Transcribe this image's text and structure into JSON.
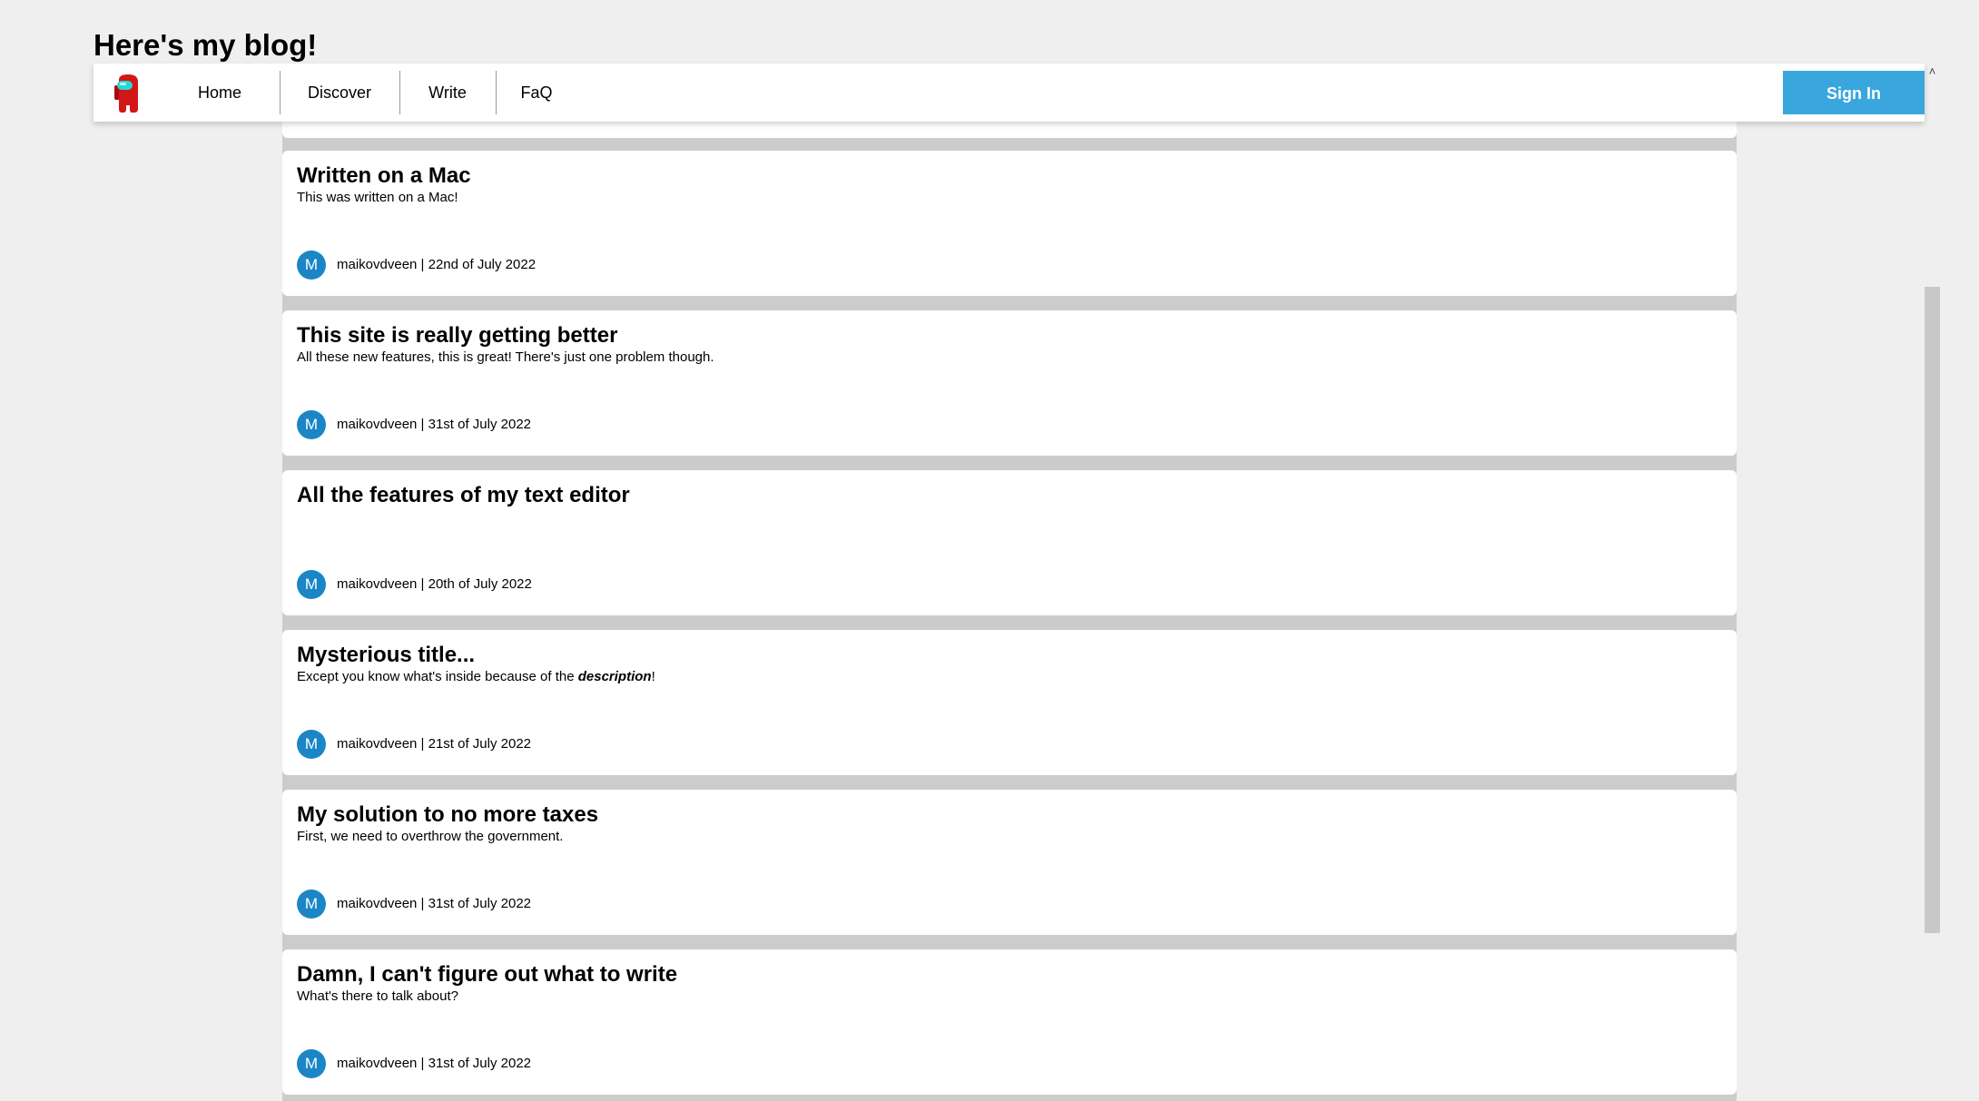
{
  "header": {
    "blog_title": "Here's my blog!"
  },
  "nav": {
    "home": "Home",
    "discover": "Discover",
    "write": "Write",
    "faq": "FaQ",
    "sign_in": "Sign In",
    "logo_icon": "among-us-crewmate-icon"
  },
  "colors": {
    "accent": "#3aa6de",
    "avatar": "#1a86c6",
    "logo_body": "#d31616",
    "logo_visor": "#29d6d6"
  },
  "posts": [
    {
      "title": "Written on a Mac",
      "description": "This was written on a Mac!",
      "avatar_letter": "M",
      "meta": "maikovdveen | 22nd of July 2022"
    },
    {
      "title": "This site is really getting better",
      "description": "All these new features, this is great! There's just one problem though.",
      "avatar_letter": "M",
      "meta": "maikovdveen | 31st of July 2022"
    },
    {
      "title": "All the features of my text editor",
      "description": "",
      "avatar_letter": "M",
      "meta": "maikovdveen | 20th of July 2022"
    },
    {
      "title": "Mysterious title...",
      "description_prefix": "Except you know what's inside because of the ",
      "description_emphasis": "description",
      "description_suffix": "!",
      "avatar_letter": "M",
      "meta": "maikovdveen | 21st of July 2022"
    },
    {
      "title": "My solution to no more taxes",
      "description": "First, we need to overthrow the government.",
      "avatar_letter": "M",
      "meta": "maikovdveen | 31st of July 2022"
    },
    {
      "title": "Damn, I can't figure out what to write",
      "description": "What's there to talk about?",
      "avatar_letter": "M",
      "meta": "maikovdveen | 31st of July 2022"
    }
  ]
}
